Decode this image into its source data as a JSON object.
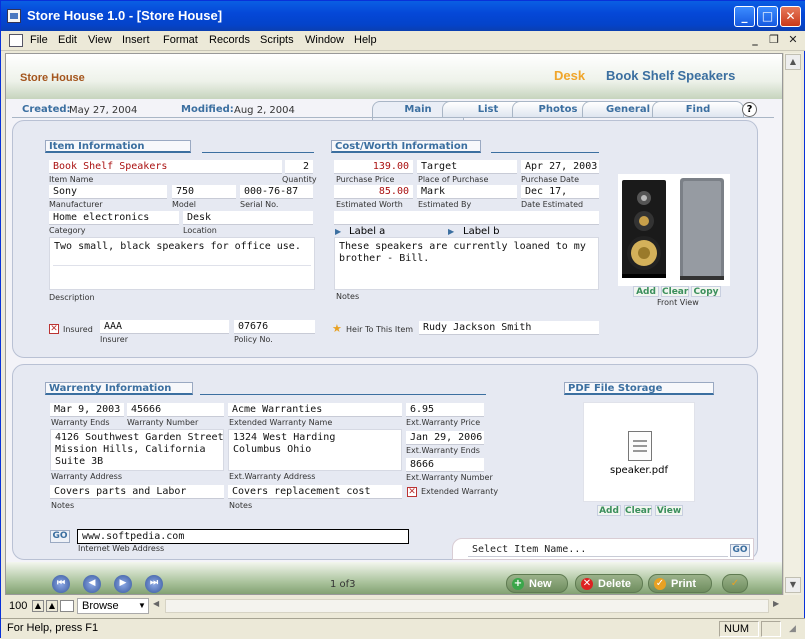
{
  "window": {
    "title": "Store House 1.0 - [Store House]",
    "minimize": "_",
    "maximize": "□",
    "close": "✕"
  },
  "menu": [
    "File",
    "Edit",
    "View",
    "Insert",
    "Format",
    "Records",
    "Scripts",
    "Window",
    "Help"
  ],
  "mdi": {
    "min": "_",
    "restore": "❐",
    "close": "✕"
  },
  "header": {
    "title": "Store House",
    "category": "Desk",
    "item": "Book Shelf Speakers"
  },
  "dates": {
    "created_label": "Created:",
    "created": "May 27, 2004",
    "modified_label": "Modified:",
    "modified": "Aug 2, 2004"
  },
  "tabs": [
    "Main",
    "List",
    "Photos",
    "General",
    "Find"
  ],
  "help": "?",
  "item_info": {
    "header": "Item Information",
    "item_name": "Book Shelf Speakers",
    "item_name_label": "Item Name",
    "quantity": "2",
    "quantity_label": "Quantity",
    "manufacturer": "Sony",
    "manufacturer_label": "Manufacturer",
    "model": "750",
    "model_label": "Model",
    "serial": "000-76-87",
    "serial_label": "Serial No.",
    "category": "Home electronics",
    "category_label": "Category",
    "location": "Desk",
    "location_label": "Location",
    "description": "Two small, black speakers for office use.",
    "description_label": "Description",
    "insured_label": "Insured",
    "insured_mark": "✕",
    "insurer": "AAA",
    "insurer_label": "Insurer",
    "policy": "07676",
    "policy_label": "Policy No."
  },
  "cost_info": {
    "header": "Cost/Worth Information",
    "purchase_price": "139.00",
    "purchase_price_label": "Purchase Price",
    "place": "Target",
    "place_label": "Place of Purchase",
    "purchase_date": "Apr 27, 2003",
    "purchase_date_label": "Purchase Date",
    "worth": "85.00",
    "worth_label": "Estimated Worth",
    "estimated_by": "Mark",
    "estimated_by_label": "Estimated By",
    "date_estimated": "Dec 17,",
    "date_estimated_label": "Date Estimated",
    "label_a": "Label a",
    "label_b": "Label b",
    "notes": "These speakers are currently loaned to my brother - Bill.",
    "notes_label": "Notes",
    "heir_label": "Heir To This Item",
    "heir": "Rudy Jackson Smith"
  },
  "photo": {
    "add": "Add",
    "clear": "Clear",
    "copy": "Copy",
    "caption": "Front View"
  },
  "warranty": {
    "header": "Warrenty Information",
    "ends": "Mar 9, 2003",
    "ends_label": "Warranty Ends",
    "number": "45666",
    "number_label": "Warranty Number",
    "ext_name": "Acme Warranties",
    "ext_name_label": "Extended Warranty Name",
    "ext_price": "6.95",
    "ext_price_label": "Ext.Warranty Price",
    "address": "4126 Southwest Garden Street\nMission Hills, California\nSuite 3B",
    "address_label": "Warranty Address",
    "ext_address": "1324 West Harding\nColumbus Ohio",
    "ext_address_label": "Ext.Warranty Address",
    "ext_ends": "Jan 29, 2006",
    "ext_ends_label": "Ext.Warranty Ends",
    "ext_number": "8666",
    "ext_number_label": "Ext.Warranty Number",
    "notes": "Covers parts and Labor",
    "notes_label": "Notes",
    "ext_notes": "Covers replacement cost",
    "ext_notes_label": "Notes",
    "extended_label": "Extended Warranty",
    "extended_mark": "✕"
  },
  "pdf": {
    "header": "PDF File Storage",
    "filename": "speaker.pdf",
    "add": "Add",
    "clear": "Clear",
    "view": "View"
  },
  "web": {
    "go": "GO",
    "url": "www.softpedia.com",
    "label": "Internet Web Address"
  },
  "select_item": {
    "placeholder": "Select Item Name...",
    "go": "GO"
  },
  "footer": {
    "record": "1 of3",
    "new": "New",
    "delete": "Delete",
    "print": "Print"
  },
  "status": {
    "zoom": "100",
    "mode": "Browse",
    "help": "For Help, press F1",
    "num": "NUM"
  },
  "colors": {
    "accent": "#3b6fa0",
    "title_brown": "#a4551d",
    "category_orange": "#f0a52a",
    "price_red": "#aa1111"
  }
}
